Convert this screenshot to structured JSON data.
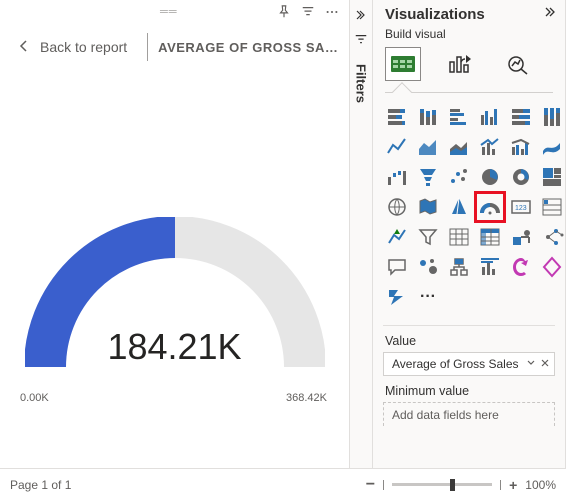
{
  "header": {
    "back_label": "Back to report",
    "title": "AVERAGE OF GROSS SAL…"
  },
  "filters": {
    "label": "Filters"
  },
  "chart_data": {
    "type": "gauge",
    "value": 184.21,
    "min": 0.0,
    "max": 368.42,
    "unit_suffix": "K",
    "value_display": "184.21K",
    "min_display": "0.00K",
    "max_display": "368.42K",
    "fill_fraction": 0.5
  },
  "viz": {
    "title": "Visualizations",
    "build_label": "Build visual",
    "more_label": "···",
    "icons": [
      "stacked-bar",
      "stacked-column",
      "clustered-bar",
      "clustered-column",
      "100-stacked-bar",
      "100-stacked-column",
      "line",
      "area",
      "stacked-area",
      "line-stacked-column",
      "line-clustered-column",
      "ribbon",
      "waterfall",
      "funnel",
      "scatter",
      "pie",
      "donut",
      "treemap",
      "map",
      "filled-map",
      "azure-map",
      "gauge",
      "card",
      "multi-row-card",
      "kpi",
      "slicer",
      "table",
      "matrix",
      "r-visual",
      "py-visual",
      "qna",
      "key-influencers",
      "decomp-tree",
      "smart-narrative",
      "paginated",
      "power-apps",
      "power-automate"
    ],
    "highlighted": "gauge"
  },
  "wells": {
    "value_label": "Value",
    "value_field": "Average of Gross Sales",
    "min_label": "Minimum value",
    "drop_placeholder": "Add data fields here"
  },
  "footer": {
    "page_label": "Page 1 of 1",
    "zoom_pct": "100%"
  },
  "colors": {
    "accent": "#3a5fcd",
    "icon": "#666666",
    "icon_accent": "#2e75b6"
  }
}
